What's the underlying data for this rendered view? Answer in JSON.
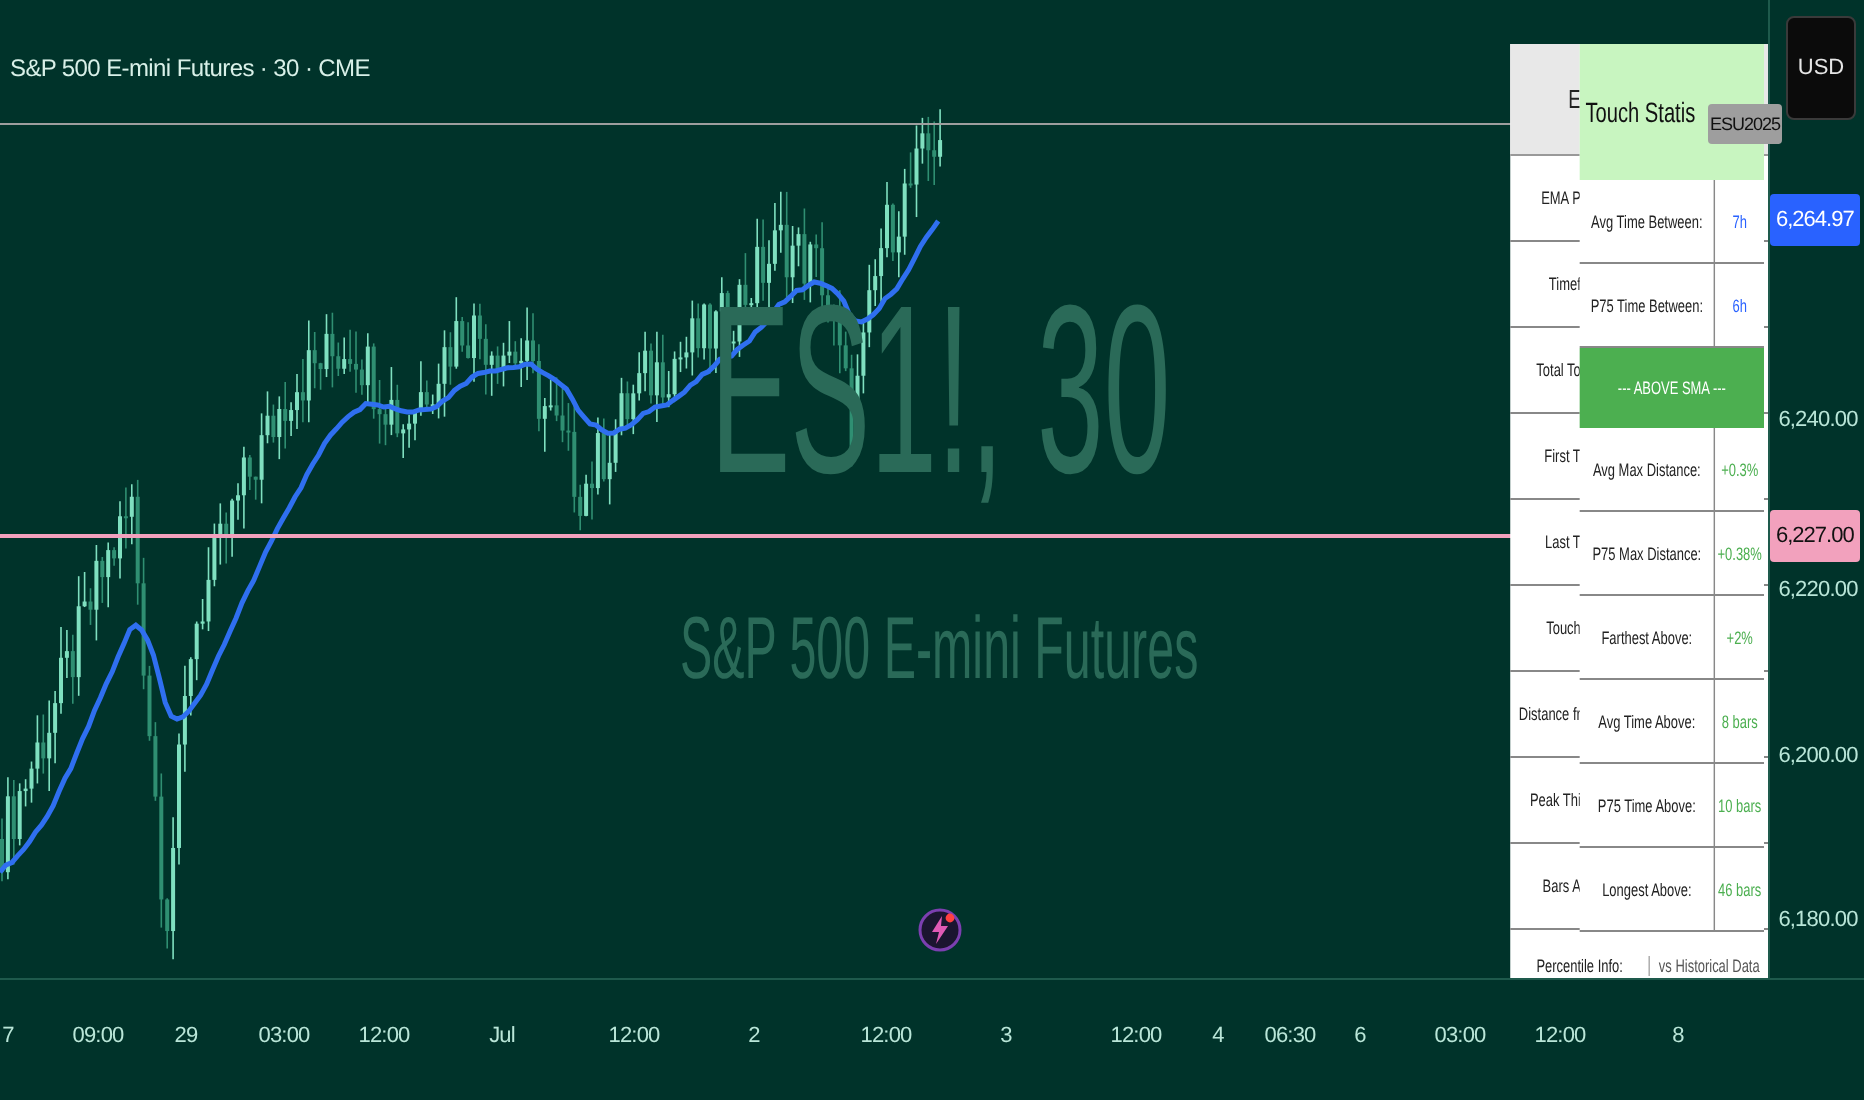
{
  "header": {
    "title": "S&P 500 E-mini Futures · 30 · CME"
  },
  "watermark": {
    "symbol": "ES1!, 30",
    "name": "S&P 500 E-mini Futures"
  },
  "price_axis": {
    "currency": "USD",
    "ticks": [
      "6,240.00",
      "6,220.00",
      "6,200.00",
      "6,180.00"
    ],
    "markers": [
      {
        "kind": "contract",
        "text": "ESU2025",
        "color": "#9e9e9e"
      },
      {
        "kind": "last_price",
        "text": "6,264.97",
        "color": "#2962ff"
      },
      {
        "kind": "level",
        "text": "6,227.00",
        "color": "#f2a1bd"
      }
    ]
  },
  "time_axis": {
    "labels": [
      "7",
      "09:00",
      "29",
      "03:00",
      "12:00",
      "Jul",
      "12:00",
      "2",
      "12:00",
      "3",
      "12:00",
      "4",
      "06:30",
      "6",
      "03:00",
      "12:00",
      "8"
    ]
  },
  "back_table": {
    "header": "E",
    "rows": [
      "EMA P",
      "Timef",
      "Total To",
      "First T",
      "Last T",
      "Touch",
      "Distance fr",
      "Peak Thi",
      "Bars A"
    ],
    "footer": {
      "label": "Percentile Info:",
      "value": "vs Historical Data"
    }
  },
  "front_table": {
    "title": "Touch Statis",
    "rows": [
      {
        "kind": "stat",
        "label": "Avg Time Between:",
        "value": "7h",
        "color": "#2962ff"
      },
      {
        "kind": "stat",
        "label": "P75 Time Between:",
        "value": "6h",
        "color": "#2962ff"
      },
      {
        "kind": "section",
        "label": "--- ABOVE SMA ---"
      },
      {
        "kind": "stat",
        "label": "Avg Max Distance:",
        "value": "+0.3%",
        "color": "#4caf50"
      },
      {
        "kind": "stat",
        "label": "P75 Max Distance:",
        "value": "+0.38%",
        "color": "#4caf50"
      },
      {
        "kind": "stat",
        "label": "Farthest Above:",
        "value": "+2%",
        "color": "#4caf50"
      },
      {
        "kind": "stat",
        "label": "Avg Time Above:",
        "value": "8 bars",
        "color": "#4caf50"
      },
      {
        "kind": "stat",
        "label": "P75 Time Above:",
        "value": "10 bars",
        "color": "#4caf50"
      },
      {
        "kind": "stat",
        "label": "Longest Above:",
        "value": "46 bars",
        "color": "#4caf50"
      }
    ]
  }
}
